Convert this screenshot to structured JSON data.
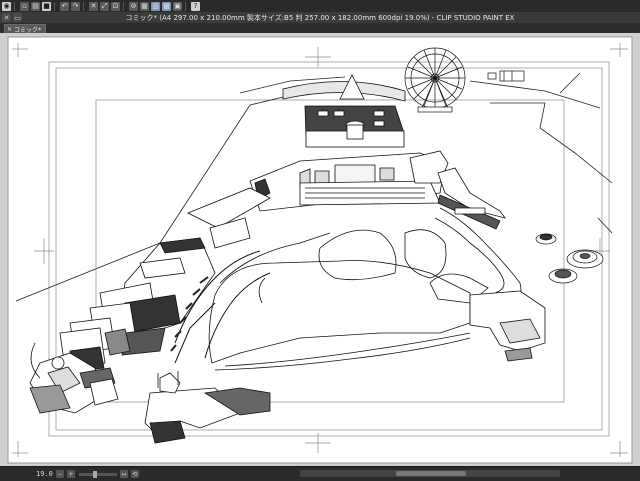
{
  "app": {
    "title": "コミック* (A4 297.00 x 210.00mm 製本サイズ:B5 判 257.00 x 182.00mm 600dpi 19.0%) - CLIP STUDIO PAINT EX"
  },
  "toolbar": {
    "buttons": [
      {
        "name": "app-menu-icon",
        "glyph": "◉"
      },
      {
        "name": "new-document-icon",
        "glyph": "▫"
      },
      {
        "name": "open-icon",
        "glyph": "▤"
      },
      {
        "name": "save-icon",
        "glyph": "■"
      },
      {
        "name": "undo-icon",
        "glyph": "↶"
      },
      {
        "name": "redo-icon",
        "glyph": "↷"
      },
      {
        "name": "clear-icon",
        "glyph": "✕"
      },
      {
        "name": "transform-icon",
        "glyph": "⤢"
      },
      {
        "name": "fit-icon",
        "glyph": "⊡"
      },
      {
        "name": "disabled-tool-icon",
        "glyph": "⊘"
      },
      {
        "name": "ruler-icon",
        "glyph": "▦"
      },
      {
        "name": "snap-icon",
        "glyph": "▧"
      },
      {
        "name": "grid-icon",
        "glyph": "▩"
      },
      {
        "name": "layer-icon",
        "glyph": "▣"
      },
      {
        "name": "help-icon",
        "glyph": "?"
      }
    ]
  },
  "window_controls": {
    "close": "✕",
    "minimize": "▭"
  },
  "tab": {
    "label": "コミック*",
    "close": "✕"
  },
  "status": {
    "zoom": "19.0"
  },
  "colors": {
    "canvas_bg": "#cfcfcf",
    "paper": "#ffffff",
    "ui_dark": "#2a2a2a"
  }
}
